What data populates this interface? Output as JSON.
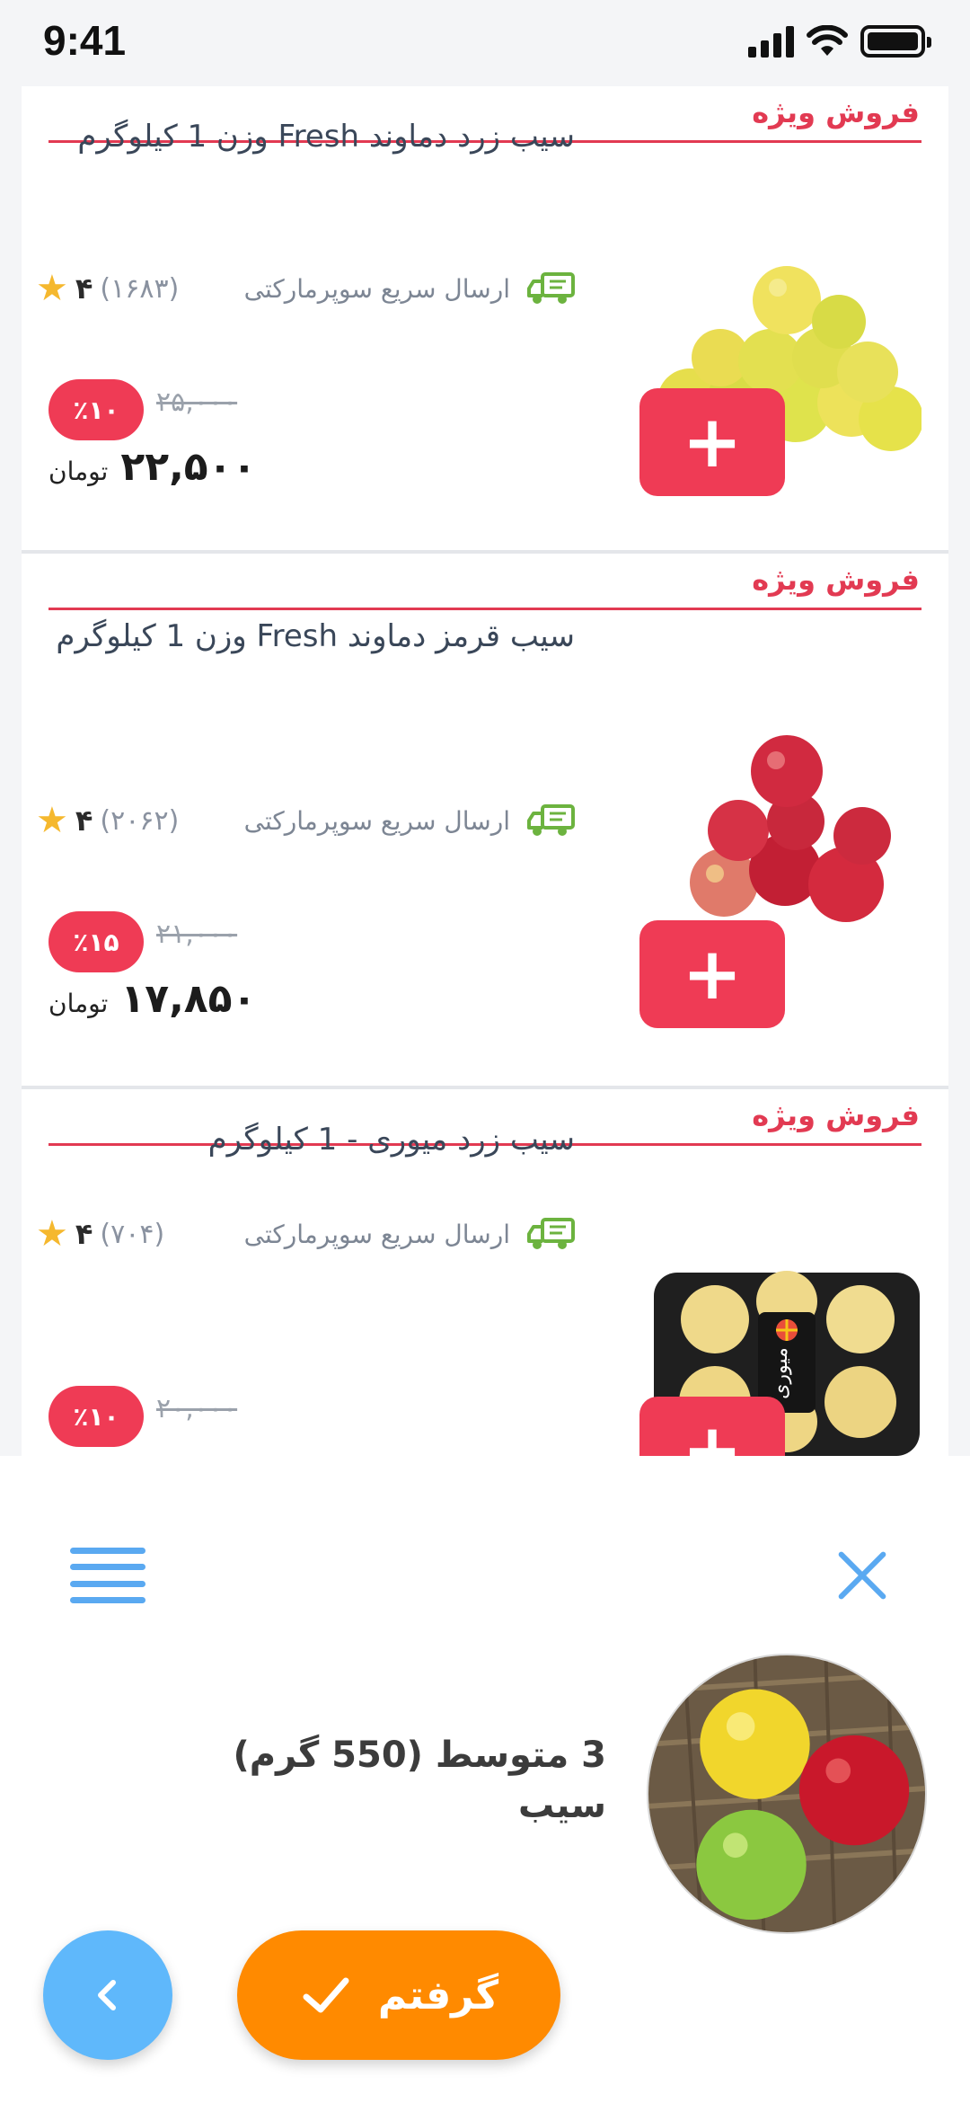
{
  "status": {
    "time": "9:41"
  },
  "products": [
    {
      "label": "فروش ویژه",
      "title": "سیب زرد دماوند Fresh وزن 1 کیلوگرم",
      "delivery": "ارسال سریع سوپرمارکتی",
      "rating_count": "(۱۶۸۳)",
      "rating": "۴",
      "discount": "٪۱۰",
      "old_price": "۲۵,۰۰۰",
      "price": "۲۲,۵۰۰",
      "currency": "تومان",
      "add": "+",
      "image": "yellow-apples"
    },
    {
      "label": "فروش ویژه",
      "title": "سیب قرمز دماوند Fresh وزن 1 کیلوگرم",
      "delivery": "ارسال سریع سوپرمارکتی",
      "rating_count": "(۲۰۶۲)",
      "rating": "۴",
      "discount": "٪۱۵",
      "old_price": "۲۱,۰۰۰",
      "price": "۱۷,۸۵۰",
      "currency": "تومان",
      "add": "+",
      "image": "red-apples"
    },
    {
      "label": "فروش ویژه",
      "title": "سیب زرد میوری - 1 کیلوگرم",
      "delivery": "ارسال سریع سوپرمارکتی",
      "rating_count": "(۷۰۴)",
      "rating": "۴",
      "discount": "٪۱۰",
      "old_price": "۲۰,۰۰۰",
      "add": "+",
      "image": "packaged-yellow-apples",
      "brand": "میوری"
    }
  ],
  "panel": {
    "item_name": "3 متوسط (550 گرم) سیب",
    "confirm_label": "گرفتم",
    "icons": [
      "menu-icon",
      "close-icon",
      "back-arrow-icon",
      "check-icon"
    ]
  },
  "colors": {
    "accent_red": "#ef3b55",
    "accent_orange": "#ff8a00",
    "accent_blue": "#5aa9f1",
    "delivery_green": "#6cb33f",
    "star_yellow": "#f5b82e"
  }
}
